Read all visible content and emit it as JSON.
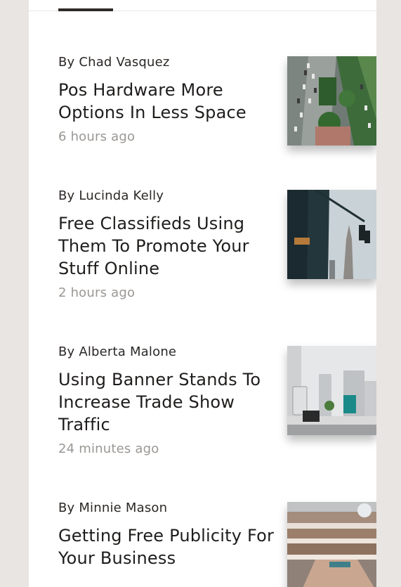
{
  "articles": [
    {
      "author": "By Chad Vasquez",
      "title_lines": [
        "Pos Hardware More",
        "Options In Less Space"
      ],
      "time": "6 hours ago",
      "image": "aerial-city-traffic-image"
    },
    {
      "author": "By Lucinda Kelly",
      "title_lines": [
        "Free Classifieds Using",
        "Them To Promote Your",
        "Stuff Online"
      ],
      "time": "2 hours ago",
      "image": "skyscraper-traffic-light-image"
    },
    {
      "author": "By Alberta Malone",
      "title_lines": [
        "Using Banner Stands To",
        "Increase Trade Show",
        "Traffic"
      ],
      "time": "24 minutes ago",
      "image": "office-desk-image"
    },
    {
      "author": "By Minnie Mason",
      "title_lines": [
        "Getting Free Publicity For",
        "Your Business"
      ],
      "time": "",
      "image": "shopping-mall-atrium-image"
    }
  ]
}
